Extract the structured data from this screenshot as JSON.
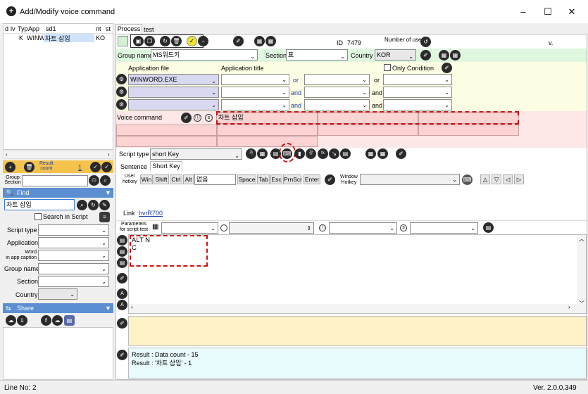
{
  "window": {
    "title": "Add/Modify voice command",
    "minimize": "–",
    "maximize": "☐",
    "close": "✕"
  },
  "left_list": {
    "columns": [
      "d",
      "lv",
      "Typ",
      "App",
      "sd1",
      "nt",
      "st"
    ],
    "row": {
      "lv": "K",
      "app": "WINW",
      "sd1": "차트 삽입",
      "st": "KO"
    }
  },
  "result_count": {
    "label_line1": "Result",
    "label_line2": "count",
    "value": "1"
  },
  "group_section": {
    "label_line1": "Group",
    "label_line2": "Section"
  },
  "find": {
    "header": "Find",
    "value": "차트 삽입",
    "search_in_script": "Search in Script"
  },
  "filters": {
    "script_type": "Script type",
    "application": "Application",
    "word_line1": "Word",
    "word_line2": "in app caption",
    "group_name": "Group name",
    "section": "Section",
    "country": "Country"
  },
  "share": {
    "header": "Share"
  },
  "tabs": {
    "process": "Process",
    "test": "test"
  },
  "toolbar": {
    "id_label": "ID",
    "id_value": "7479",
    "number_of_use": "Number of use",
    "v_mark": "v."
  },
  "group": {
    "label": "Group name",
    "value": "MS워드키",
    "section_label": "Section",
    "section_value": "표",
    "country_label": "Country",
    "country_value": "KOR"
  },
  "application": {
    "file_label": "Application file",
    "title_label": "Application title",
    "only_condition": "Only Condition",
    "file_value": "WINWORD.EXE",
    "or": "or",
    "and": "and"
  },
  "voice": {
    "label": "Voice command",
    "value": "차트 삽입"
  },
  "script": {
    "type_label": "Script type",
    "type_value": "short Key"
  },
  "sub_tabs": {
    "sentence": "Sentence",
    "short_key": "Short Key"
  },
  "hotkey": {
    "user_line1": "User",
    "user_line2": "hotkey",
    "keys": [
      "Win",
      "Shift",
      "Ctrl",
      "Alt"
    ],
    "value": "없음",
    "keys2": [
      "Space",
      "Tab",
      "Esc",
      "PrnScr",
      "Enter"
    ],
    "window_line1": "Window",
    "window_line2": "Hotkey"
  },
  "link": {
    "label": "Link",
    "value": "hvrR700"
  },
  "params": {
    "line1": "Parameters",
    "line2": "for script test"
  },
  "editor": {
    "line1": "ALT N",
    "line2": "C"
  },
  "result": {
    "line1": "Result : Data count - 15",
    "line2": "Result : '차트 삽입' - 1"
  },
  "status": {
    "line_no": "Line No: 2",
    "version": "Ver. 2.0.0.349"
  }
}
